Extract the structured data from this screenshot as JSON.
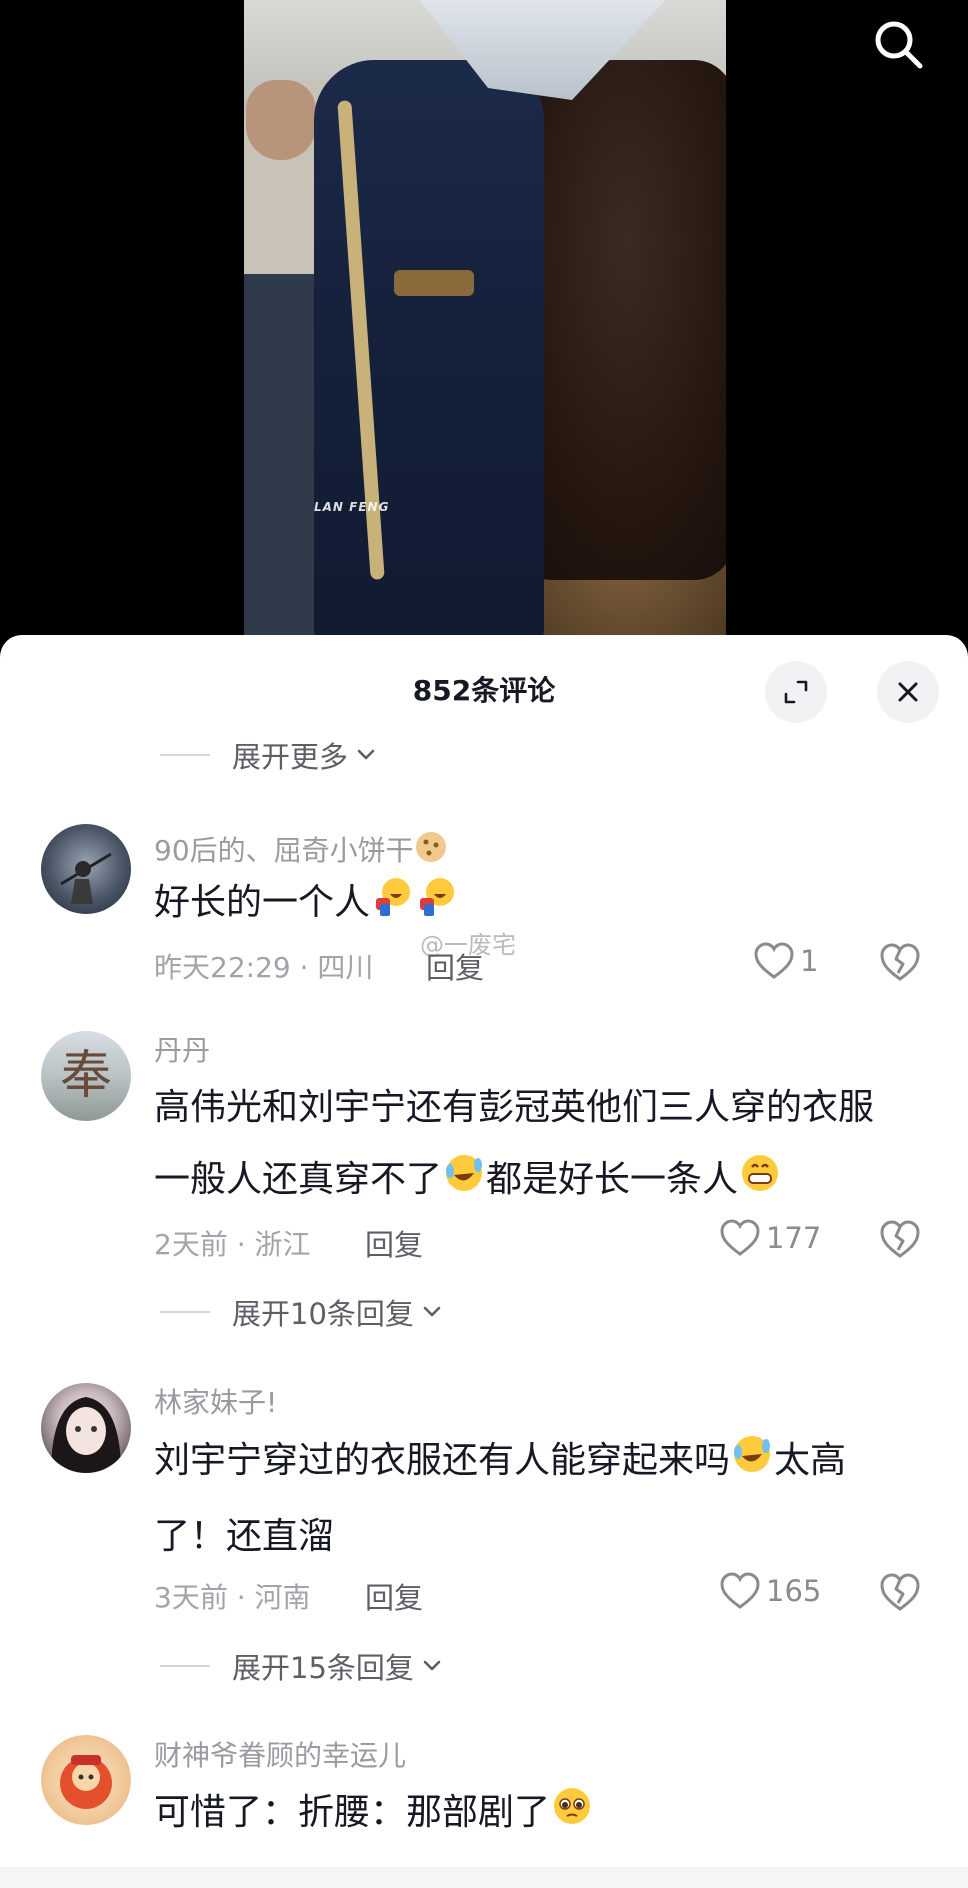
{
  "video": {
    "watermark": "LAN FENG"
  },
  "sheet": {
    "title": "852条评论"
  },
  "top_expand": "展开更多",
  "comments": [
    {
      "user": "90后的、屈奇小饼干",
      "text": "好长的一个人",
      "time_location": "昨天22:29 · 四川",
      "reply": "回复",
      "likes": "1"
    },
    {
      "user": "丹丹",
      "text_line1": "高伟光和刘宇宁还有彭冠英他们三人穿的衣服",
      "text_line2a": "一般人还真穿不了",
      "text_line2b": "都是好长一条人",
      "time_location": "2天前 · 浙江",
      "reply": "回复",
      "likes": "177",
      "expand_replies": "展开10条回复"
    },
    {
      "user": "林家妹子!",
      "text_line1a": "刘宇宁穿过的衣服还有人能穿起来吗",
      "text_line1b": "太高",
      "text_line2": "了！还直溜",
      "time_location": "3天前 · 河南",
      "reply": "回复",
      "likes": "165",
      "expand_replies": "展开15条回复"
    },
    {
      "user": "财神爷眷顾的幸运儿",
      "text": "可惜了：折腰：那部剧了"
    }
  ],
  "watermark_overlay": "@一废宅",
  "icons": {
    "search": "search-icon",
    "expand": "expand-icon",
    "close": "close-icon",
    "chevron": "chevron-down-icon",
    "heart": "heart-icon",
    "dislike": "broken-heart-icon"
  },
  "colors": {
    "text_primary": "#161823",
    "text_secondary": "#9a9ba1",
    "sheet_bg": "#ffffff",
    "video_bg": "#000000"
  }
}
